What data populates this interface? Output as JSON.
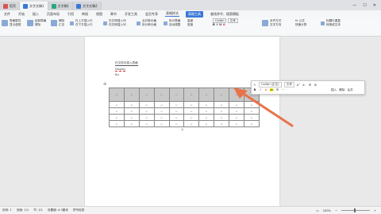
{
  "tabs": [
    {
      "label": "稻壳",
      "color": "#d9534f"
    },
    {
      "label": "文字文稿1",
      "color": "#3a78d8",
      "active": true
    },
    {
      "label": "文字稿1",
      "color": "#2aa87a"
    },
    {
      "label": "文字文稿2",
      "color": "#3a78d8"
    }
  ],
  "menu": [
    "文件",
    "开始",
    "插入",
    "页面布局",
    "引用",
    "审阅",
    "视图",
    "章节",
    "开发工具",
    "会员专享",
    "表格样式",
    "表格工具",
    "查找命令、搜索模板"
  ],
  "menu_selected": "表格工具",
  "menu_underlined": "表格样式",
  "ribbon": {
    "g1": [
      "表格属性",
      "显示虚框"
    ],
    "g2": [
      "绘制表格",
      "擦除"
    ],
    "g3": [
      "删除",
      "汇总"
    ],
    "g4": [
      "在上方插入行",
      "在下方插入行"
    ],
    "g5": [
      "在左侧插入列",
      "在右侧插入列"
    ],
    "g6": [
      "合并单元格",
      "拆分单元格"
    ],
    "g7": [
      "拆分表格",
      "自动调整"
    ],
    "g8": [
      "高度",
      "宽度"
    ],
    "font": "Calibri",
    "fontsize": "五号",
    "g9": [
      "对齐方式",
      "文字方向"
    ],
    "g10": [
      "fx 公式",
      "快速计算"
    ],
    "g11": [
      "标题行重复",
      "转换成文本"
    ]
  },
  "doc": {
    "line1": "在文档中插入表格",
    "line2": "Display",
    "line3": "Bo"
  },
  "table": {
    "cols": 10,
    "rows": 5,
    "cell_mark": "↵"
  },
  "mini": {
    "font": "Calibri (正文)",
    "size": "五号",
    "row1_btns": [
      "A⁺",
      "A⁻",
      "☰",
      "⊞"
    ],
    "row2_btns": [
      "B",
      "I",
      "A",
      "ab",
      "☰",
      "⋯"
    ],
    "right_labels": [
      "插入",
      "删除",
      "合并"
    ]
  },
  "status": {
    "page": "页码: 1",
    "pages": "页面: 1/1",
    "section": "节: 1/1",
    "setval": "设置值: 4.3厘米",
    "spell": "拼写检查",
    "zoom": "100%"
  },
  "colors": {
    "accent": "#3a78d8",
    "arrow": "#e8734a"
  }
}
